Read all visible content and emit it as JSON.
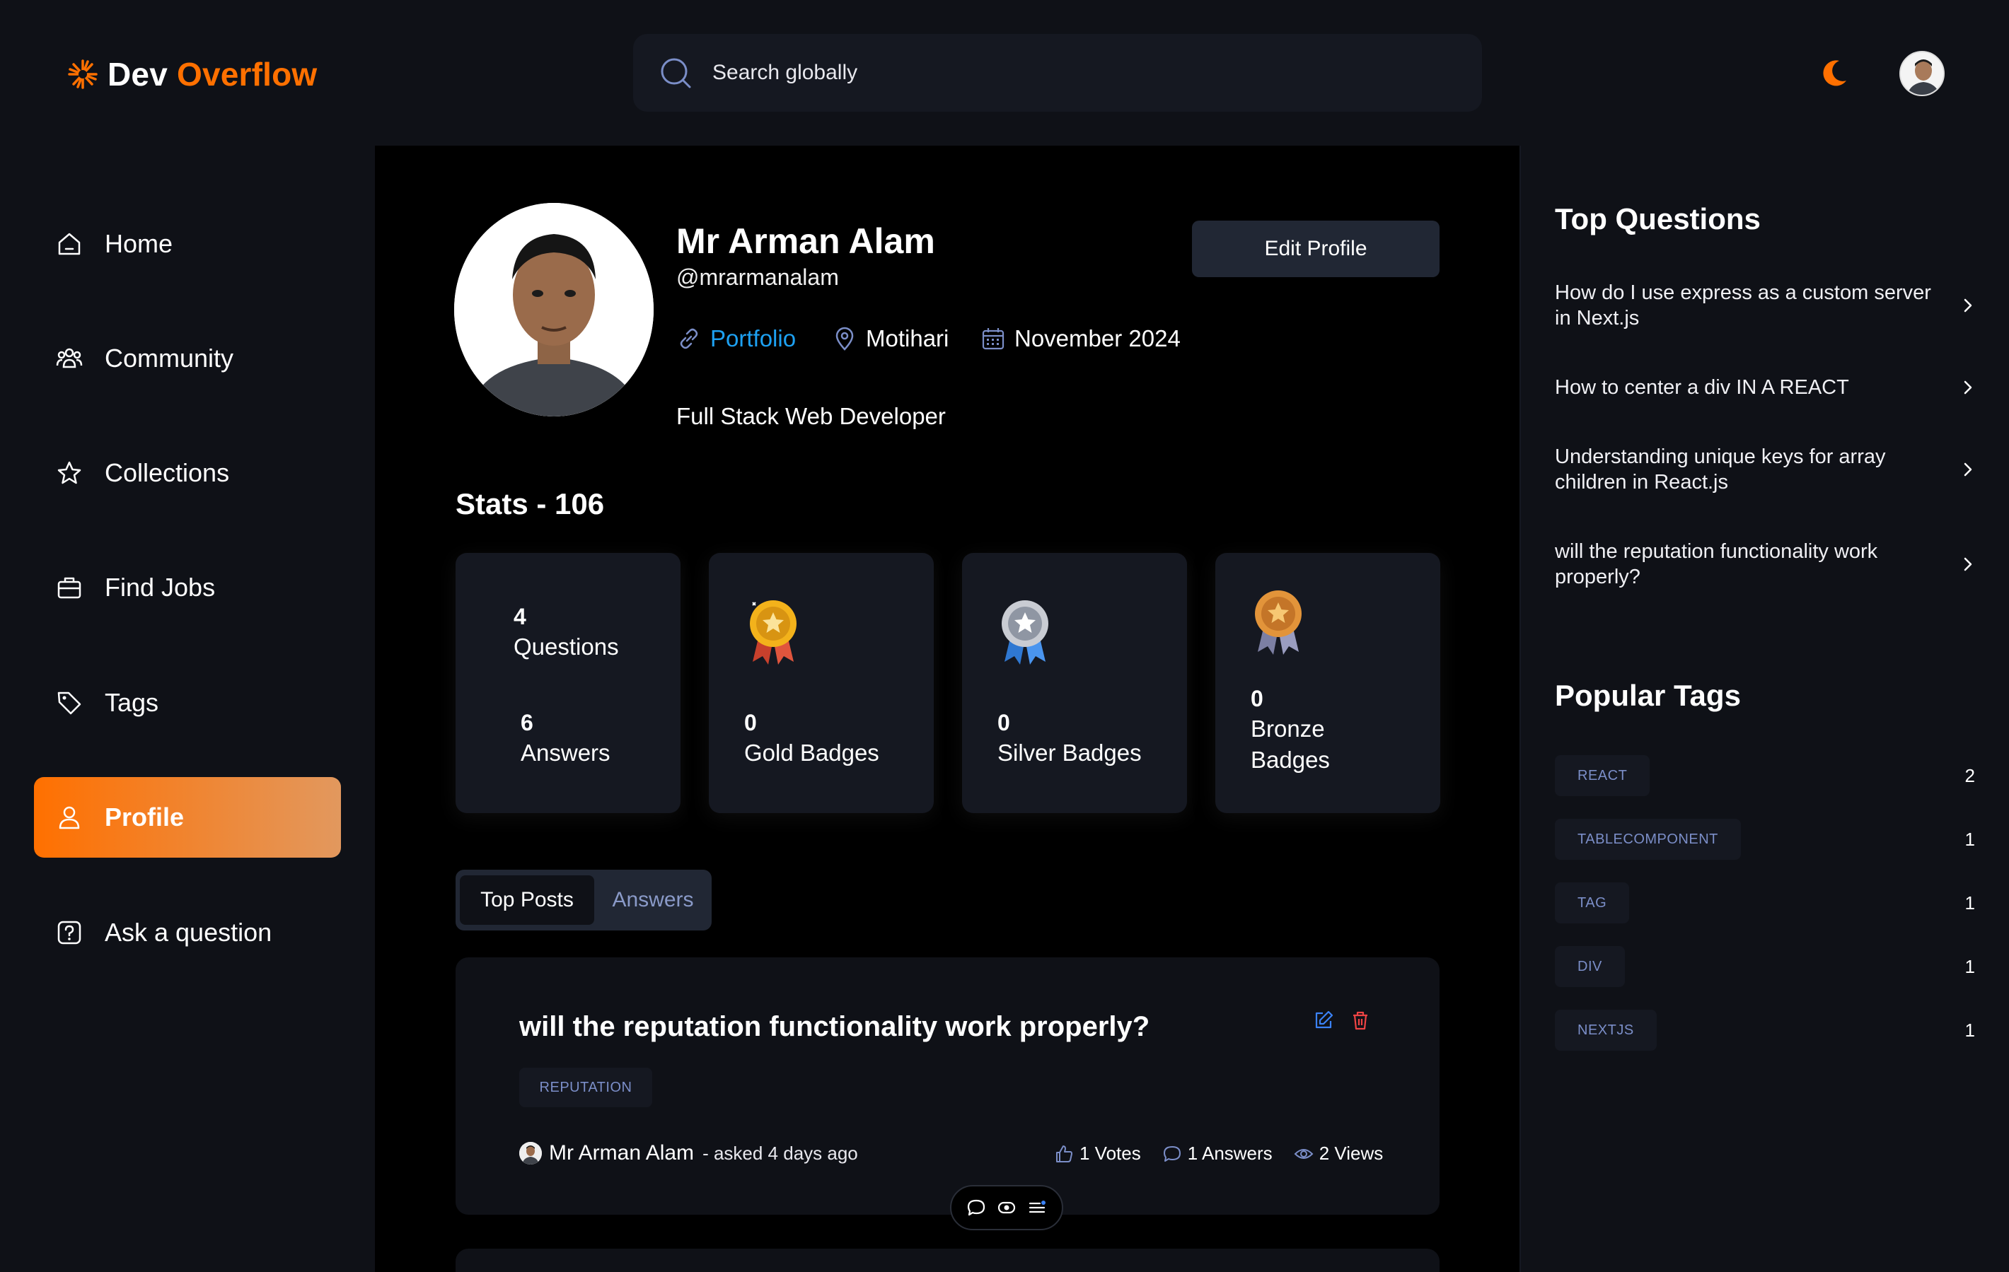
{
  "header": {
    "logo_primary": "Dev",
    "logo_accent": "Overflow",
    "search_placeholder": "Search globally"
  },
  "sidebar": {
    "items": [
      {
        "label": "Home",
        "icon": "home-icon"
      },
      {
        "label": "Community",
        "icon": "community-icon"
      },
      {
        "label": "Collections",
        "icon": "star-icon"
      },
      {
        "label": "Find Jobs",
        "icon": "briefcase-icon"
      },
      {
        "label": "Tags",
        "icon": "tag-icon"
      },
      {
        "label": "Profile",
        "icon": "user-icon",
        "active": true
      },
      {
        "label": "Ask a question",
        "icon": "question-icon"
      }
    ]
  },
  "profile": {
    "name": "Mr Arman Alam",
    "username": "@mrarmanalam",
    "portfolio_label": "Portfolio",
    "location": "Motihari",
    "joined": "November 2024",
    "bio": "Full Stack Web Developer",
    "edit_label": "Edit Profile"
  },
  "stats": {
    "title": "Stats - 106",
    "questions_count": "4",
    "questions_label": "Questions",
    "answers_count": "6",
    "answers_label": "Answers",
    "gold_count": "0",
    "gold_label": "Gold Badges",
    "silver_count": "0",
    "silver_label": "Silver Badges",
    "bronze_count": "0",
    "bronze_label_1": "Bronze",
    "bronze_label_2": "Badges"
  },
  "tabs": {
    "top_posts": "Top Posts",
    "answers": "Answers"
  },
  "post": {
    "title": "will the reputation functionality work properly?",
    "tag": "REPUTATION",
    "author": "Mr Arman Alam",
    "time": "- asked 4 days ago",
    "votes": "1 Votes",
    "answers": "1 Answers",
    "views": "2 Views"
  },
  "right_sidebar": {
    "top_questions_title": "Top Questions",
    "questions": [
      "How do I use express as a custom server in Next.js",
      "How to center a div IN A REACT",
      "Understanding unique keys for array children in React.js",
      "will the reputation functionality work properly?"
    ],
    "popular_tags_title": "Popular Tags",
    "tags": [
      {
        "name": "REACT",
        "count": "2"
      },
      {
        "name": "TABLECOMPONENT",
        "count": "1"
      },
      {
        "name": "TAG",
        "count": "1"
      },
      {
        "name": "DIV",
        "count": "1"
      },
      {
        "name": "NEXTJS",
        "count": "1"
      }
    ]
  },
  "colors": {
    "accent": "#ff7000",
    "background": "#0f1117",
    "main_background": "#000000",
    "card": "#151821",
    "link": "#1da1f2",
    "tag_text": "#7b8ec8"
  }
}
